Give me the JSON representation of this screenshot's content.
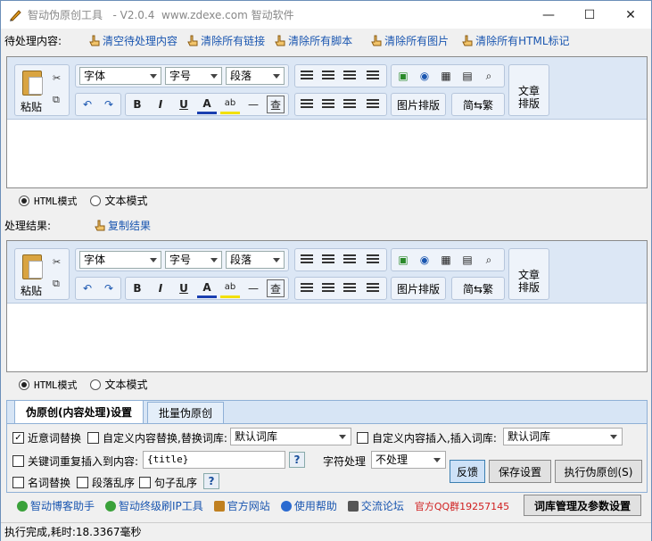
{
  "title_bar": {
    "app_name": "智动伪原创工具",
    "version": "- V2.0.4",
    "site": "www.zdexe.com",
    "brand": "智动软件"
  },
  "input_section": {
    "label": "待处理内容:",
    "actions": [
      {
        "label": "清空待处理内容"
      },
      {
        "label": "清除所有链接"
      },
      {
        "label": "清除所有脚本"
      },
      {
        "label": "清除所有图片"
      },
      {
        "label": "清除所有HTML标记"
      }
    ]
  },
  "toolbar": {
    "paste": "粘贴",
    "font": "字体",
    "size": "字号",
    "paragraph": "段落",
    "bold": "B",
    "italic": "I",
    "underline": "U",
    "text_color": "A",
    "highlight": "ab",
    "hr": "—",
    "find": "查",
    "image_layout": "图片排版",
    "trad_simp": "简⇆繁",
    "article_layout_1": "文章",
    "article_layout_2": "排版"
  },
  "modes": {
    "html": "HTML模式",
    "text": "文本模式",
    "selected": "html"
  },
  "output_section": {
    "label": "处理结果:",
    "copy_label": "复制结果"
  },
  "settings_panel": {
    "tabs": [
      {
        "label": "伪原创(内容处理)设置",
        "active": true
      },
      {
        "label": "批量伪原创",
        "active": false
      }
    ],
    "synonym_replace": {
      "label": "近意词替换",
      "checked": true
    },
    "custom_replace": {
      "label": "自定义内容替换,替换词库:",
      "checked": false,
      "value": "默认词库"
    },
    "custom_insert": {
      "label": "自定义内容插入,插入词库:",
      "checked": false,
      "value": "默认词库"
    },
    "keyword_insert": {
      "label": "关键词重复插入到内容:",
      "checked": false,
      "value": "{title}"
    },
    "char_process": {
      "label": "字符处理",
      "value": "不处理"
    },
    "noun_replace": {
      "label": "名词替换",
      "checked": false
    },
    "para_shuffle": {
      "label": "段落乱序",
      "checked": false
    },
    "sentence_shuffle": {
      "label": "句子乱序",
      "checked": false
    },
    "help": "?",
    "feedback": "反馈",
    "save": "保存设置",
    "execute": "执行伪原创(S)"
  },
  "footer": {
    "links": [
      {
        "label": "智动博客助手"
      },
      {
        "label": "智动终级刷IP工具"
      },
      {
        "label": "官方网站"
      },
      {
        "label": "使用帮助"
      },
      {
        "label": "交流论坛"
      }
    ],
    "qq": "官方QQ群19257145",
    "manage": "词库管理及参数设置"
  },
  "status": "执行完成,耗时:18.3367毫秒",
  "colors": {
    "accent": "#1a56b0",
    "toolbar": "#dce7f5",
    "qq": "#d02020"
  }
}
